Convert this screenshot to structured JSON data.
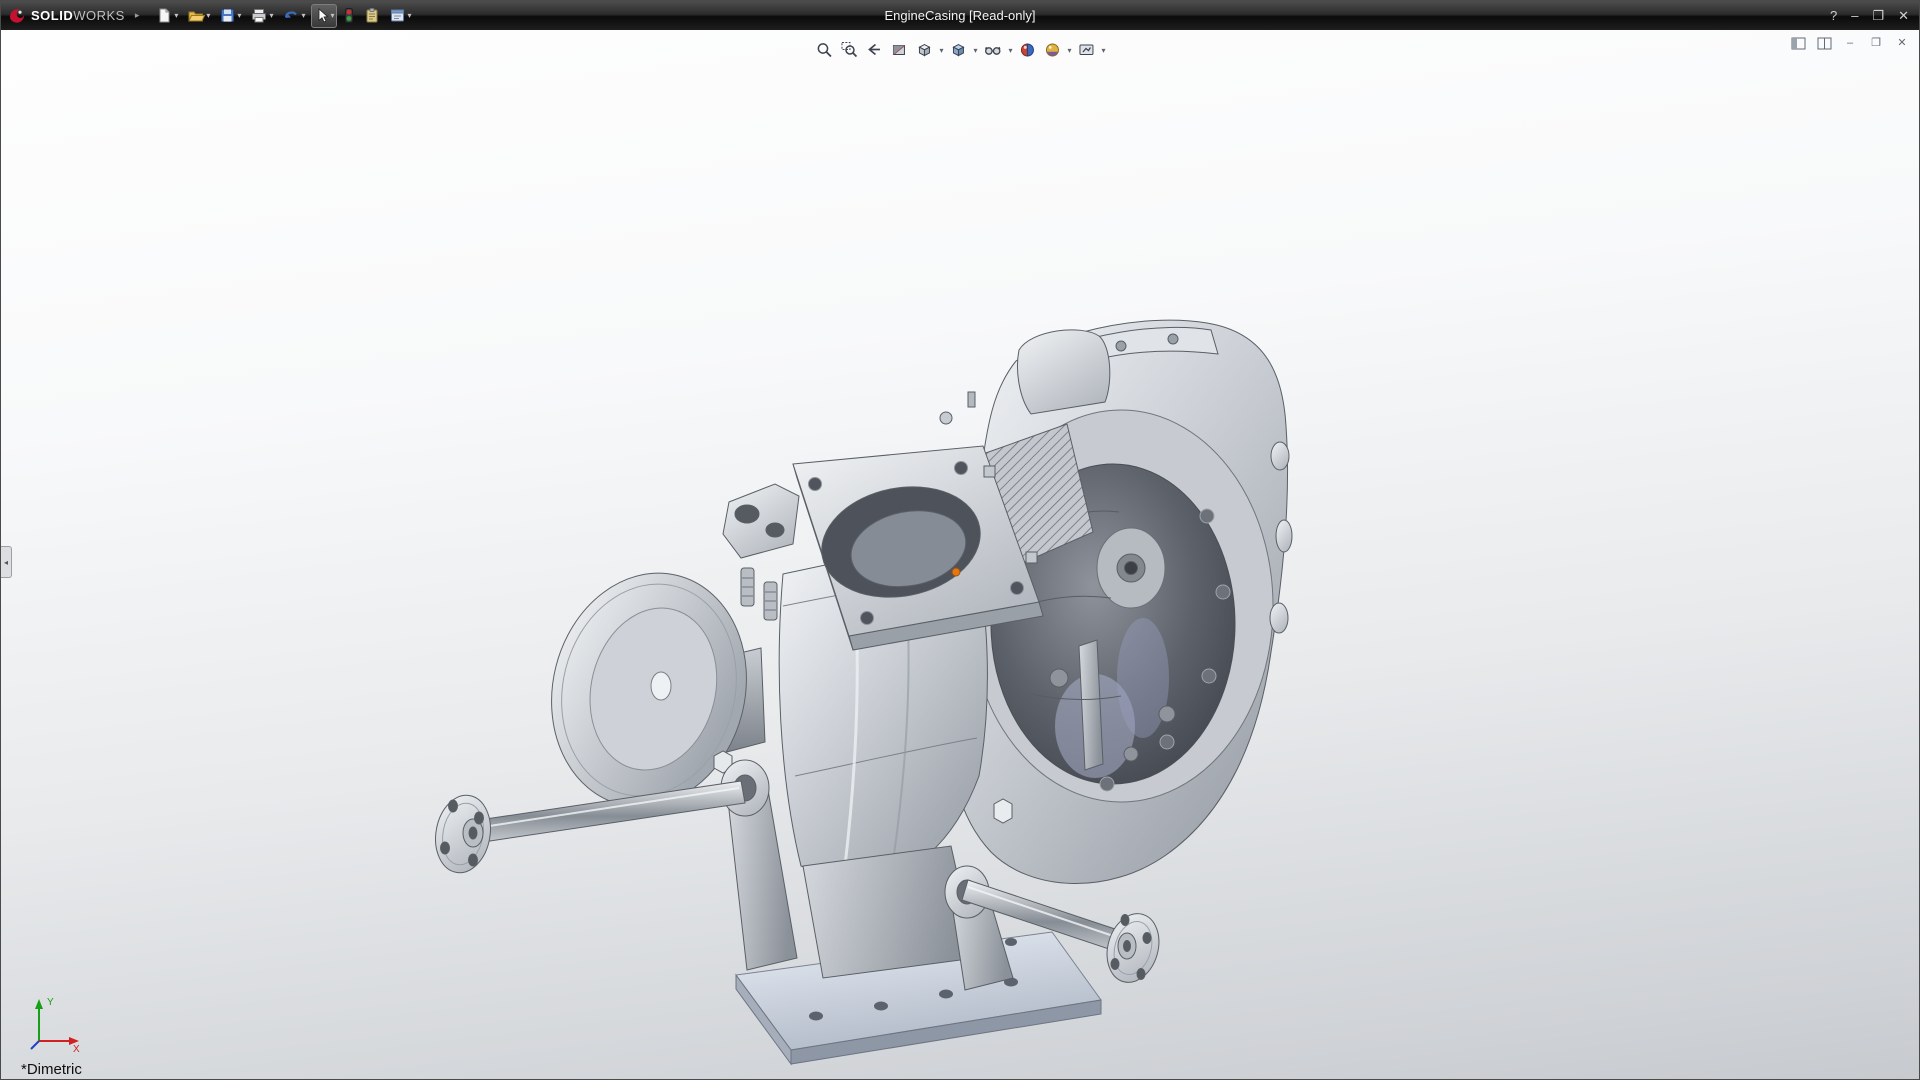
{
  "titlebar": {
    "brand_solid": "SOLID",
    "brand_works": "WORKS",
    "title": "EngineCasing [Read-only]",
    "controls": {
      "help": "?",
      "minimize": "–",
      "maximize": "❐",
      "close": "✕"
    }
  },
  "main_toolbar": {
    "items": [
      "new-document",
      "open-document",
      "save",
      "print",
      "undo",
      "select",
      "color-swatch",
      "clipboard",
      "options"
    ]
  },
  "headsup_toolbar": {
    "items": [
      "zoom-to-fit",
      "zoom-to-area",
      "previous-view",
      "section-view",
      "view-orientation",
      "display-style",
      "hide-show-items",
      "edit-appearance",
      "apply-scene",
      "view-settings"
    ]
  },
  "doc_window_controls": {
    "minimize": "–",
    "restore": "❐",
    "close": "✕"
  },
  "viewport": {
    "orientation_label": "*Dimetric",
    "triad": {
      "x_label": "X",
      "y_label": "Y"
    }
  },
  "colors": {
    "triad_x": "#d02020",
    "triad_y": "#16a016",
    "triad_z": "#2040c8",
    "selection_orange": "#e07818",
    "brand_red": "#c41230"
  }
}
